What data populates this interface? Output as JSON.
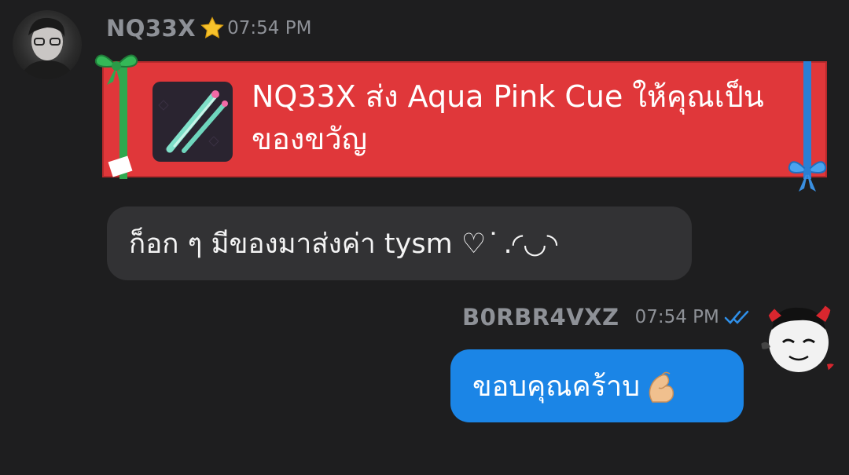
{
  "messages": [
    {
      "sender": "NQ33X",
      "timestamp": "07:54 PM",
      "badge": "star-icon",
      "gift": {
        "text": "NQ33X ส่ง Aqua Pink Cue ให้คุณเป็นของขวัญ",
        "item_icon": "pool-cue-icon",
        "colors": {
          "card": "#e0373a",
          "ribbon_left": "#2fa84f",
          "ribbon_right": "#2a7fd4"
        }
      },
      "text": "ก็อก ๆ มีของมาส่งค่า tysm ♡ ͘ .◜◡◝"
    },
    {
      "sender": "B0RBR4VXZ",
      "timestamp": "07:54 PM",
      "read_status": "double-check-icon",
      "text": "ขอบคุณคร้าบ",
      "emoji": "pinched-fingers-emoji"
    }
  ],
  "colors": {
    "background": "#1e1e1f",
    "incoming_bubble": "#323234",
    "outgoing_bubble": "#1b85e6",
    "meta_text": "#8e9197"
  }
}
